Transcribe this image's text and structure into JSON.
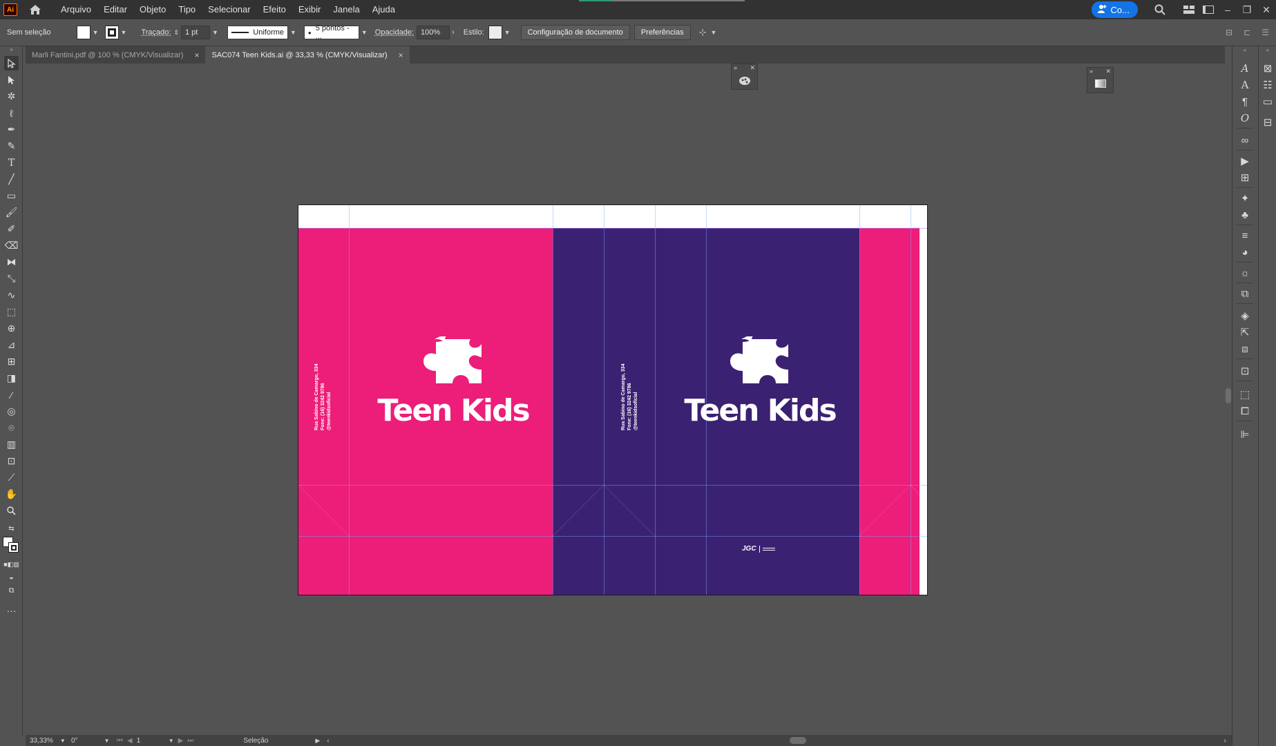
{
  "menubar": {
    "app_logo": "Ai",
    "items": [
      "Arquivo",
      "Editar",
      "Objeto",
      "Tipo",
      "Selecionar",
      "Efeito",
      "Exibir",
      "Janela",
      "Ajuda"
    ],
    "share_label": "Co..."
  },
  "controlbar": {
    "selection": "Sem seleção",
    "stroke_label": "Traçado:",
    "stroke_weight": "1 pt",
    "stroke_profile": "Uniforme",
    "brush": "5 pontos - ...",
    "opacity_label": "Opacidade:",
    "opacity_value": "100%",
    "style_label": "Estilo:",
    "doc_setup_button": "Configuração de documento",
    "prefs_button": "Preferências"
  },
  "tabs": [
    {
      "label": "Marli Fantini.pdf @ 100 % (CMYK/Visualizar)",
      "close": "×",
      "active": false
    },
    {
      "label": "SAC074 Teen Kids.ai @ 33,33 % (CMYK/Visualizar)",
      "close": "×",
      "active": true
    }
  ],
  "artwork": {
    "brand_name": "Teen Kids",
    "address_line1": "Rua Sabino de Camargo, 334",
    "address_line2": "Fone: (16) 3242 9786",
    "address_line3": "@teenkidsoficial",
    "footer_logo": "JGC",
    "colors": {
      "pink": "#ec1e79",
      "purple": "#3b2172"
    }
  },
  "statusbar": {
    "zoom": "33,33%",
    "rotation": "0°",
    "artboard_number": "1",
    "tool_name": "Seleção"
  }
}
